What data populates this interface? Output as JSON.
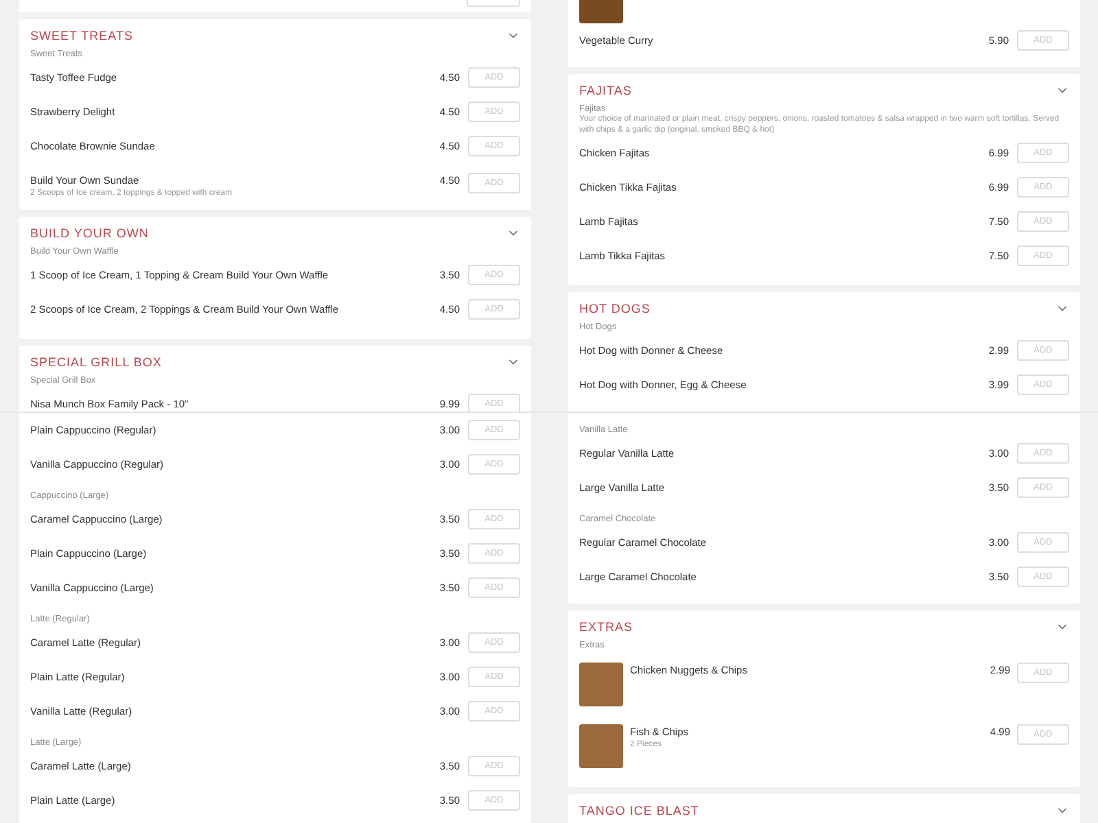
{
  "tiles": [
    {
      "blocks": [
        {
          "kind": "stub"
        },
        {
          "kind": "card",
          "title": "SWEET TREATS",
          "entries": [
            {
              "kind": "label",
              "text": "Sweet Treats"
            },
            {
              "kind": "item",
              "name": "Tasty Toffee Fudge",
              "price": "4.50",
              "button": "ADD"
            },
            {
              "kind": "item",
              "name": "Strawberry Delight",
              "price": "4.50",
              "button": "ADD"
            },
            {
              "kind": "item",
              "name": "Chocolate Brownie Sundae",
              "price": "4.50",
              "button": "ADD"
            },
            {
              "kind": "item",
              "name": "Build Your Own Sundae",
              "note": "2 Scoops of Ice cream, 2 toppings & topped with cream",
              "price": "4.50",
              "button": "ADD"
            }
          ]
        },
        {
          "kind": "card",
          "title": "BUILD YOUR OWN",
          "entries": [
            {
              "kind": "label",
              "text": "Build Your Own Waffle"
            },
            {
              "kind": "item",
              "name": "1 Scoop of Ice Cream, 1 Topping & Cream Build Your Own Waffle",
              "price": "3.50",
              "button": "ADD"
            },
            {
              "kind": "item",
              "name": "2 Scoops of Ice Cream, 2 Toppings & Cream Build Your Own Waffle",
              "price": "4.50",
              "button": "ADD"
            }
          ]
        },
        {
          "kind": "card",
          "title": "SPECIAL GRILL BOX",
          "entries": [
            {
              "kind": "label",
              "text": "Special Grill Box"
            },
            {
              "kind": "item",
              "name": "Nisa Munch Box Family Pack - 10\"",
              "price": "9.99",
              "button": "ADD"
            }
          ]
        }
      ]
    },
    {
      "blocks": [
        {
          "kind": "continued",
          "entries": [
            {
              "kind": "photo"
            },
            {
              "kind": "item",
              "name": "Vegetable Curry",
              "price": "5.90",
              "button": "ADD"
            }
          ]
        },
        {
          "kind": "card",
          "title": "FAJITAS",
          "entries": [
            {
              "kind": "label",
              "text": "Fajitas"
            },
            {
              "kind": "description",
              "text": "Your choice of marinated or plain meat, crispy peppers, onions, roasted tomatoes & salsa wrapped in two warm soft tortillas. Served with chips & a garlic dip (original, smoked BBQ & hot)"
            },
            {
              "kind": "item",
              "name": "Chicken Fajitas",
              "price": "6.99",
              "button": "ADD"
            },
            {
              "kind": "item",
              "name": "Chicken Tikka Fajitas",
              "price": "6.99",
              "button": "ADD"
            },
            {
              "kind": "item",
              "name": "Lamb Fajitas",
              "price": "7.50",
              "button": "ADD"
            },
            {
              "kind": "item",
              "name": "Lamb Tikka Fajitas",
              "price": "7.50",
              "button": "ADD"
            }
          ]
        },
        {
          "kind": "card",
          "title": "HOT DOGS",
          "entries": [
            {
              "kind": "label",
              "text": "Hot Dogs"
            },
            {
              "kind": "item",
              "name": "Hot Dog with Donner & Cheese",
              "price": "2.99",
              "button": "ADD"
            },
            {
              "kind": "item",
              "name": "Hot Dog with Donner, Egg & Cheese",
              "price": "3.99",
              "button": "ADD"
            }
          ]
        }
      ]
    },
    {
      "blocks": [
        {
          "kind": "continued",
          "entries": [
            {
              "kind": "item",
              "name": "Plain Cappuccino (Regular)",
              "price": "3.00",
              "button": "ADD"
            },
            {
              "kind": "item",
              "name": "Vanilla Cappuccino (Regular)",
              "price": "3.00",
              "button": "ADD"
            },
            {
              "kind": "label",
              "text": "Cappuccino (Large)"
            },
            {
              "kind": "item",
              "name": "Caramel Cappuccino (Large)",
              "price": "3.50",
              "button": "ADD"
            },
            {
              "kind": "item",
              "name": "Plain Cappuccino (Large)",
              "price": "3.50",
              "button": "ADD"
            },
            {
              "kind": "item",
              "name": "Vanilla Cappuccino (Large)",
              "price": "3.50",
              "button": "ADD"
            },
            {
              "kind": "label",
              "text": "Latte (Regular)"
            },
            {
              "kind": "item",
              "name": "Caramel Latte (Regular)",
              "price": "3.00",
              "button": "ADD"
            },
            {
              "kind": "item",
              "name": "Plain Latte (Regular)",
              "price": "3.00",
              "button": "ADD"
            },
            {
              "kind": "item",
              "name": "Vanilla Latte (Regular)",
              "price": "3.00",
              "button": "ADD"
            },
            {
              "kind": "label",
              "text": "Latte (Large)"
            },
            {
              "kind": "item",
              "name": "Caramel Latte (Large)",
              "price": "3.50",
              "button": "ADD"
            },
            {
              "kind": "item",
              "name": "Plain Latte (Large)",
              "price": "3.50",
              "button": "ADD"
            }
          ]
        }
      ]
    },
    {
      "blocks": [
        {
          "kind": "continued",
          "entries": [
            {
              "kind": "label",
              "text": "Vanilla Latte"
            },
            {
              "kind": "item",
              "name": "Regular Vanilla Latte",
              "price": "3.00",
              "button": "ADD"
            },
            {
              "kind": "item",
              "name": "Large Vanilla Latte",
              "price": "3.50",
              "button": "ADD"
            },
            {
              "kind": "label",
              "text": "Caramel Chocolate"
            },
            {
              "kind": "item",
              "name": "Regular Caramel Chocolate",
              "price": "3.00",
              "button": "ADD"
            },
            {
              "kind": "item",
              "name": "Large Caramel Chocolate",
              "price": "3.50",
              "button": "ADD"
            }
          ]
        },
        {
          "kind": "card",
          "title": "EXTRAS",
          "entries": [
            {
              "kind": "label",
              "text": "Extras"
            },
            {
              "kind": "photo_item",
              "name": "Chicken Nuggets & Chips",
              "price": "2.99",
              "button": "ADD"
            },
            {
              "kind": "photo_item",
              "name": "Fish & Chips",
              "note": "2 Pieces",
              "price": "4.99",
              "button": "ADD"
            }
          ]
        },
        {
          "kind": "card",
          "title": "TANGO ICE BLAST"
        }
      ]
    }
  ]
}
